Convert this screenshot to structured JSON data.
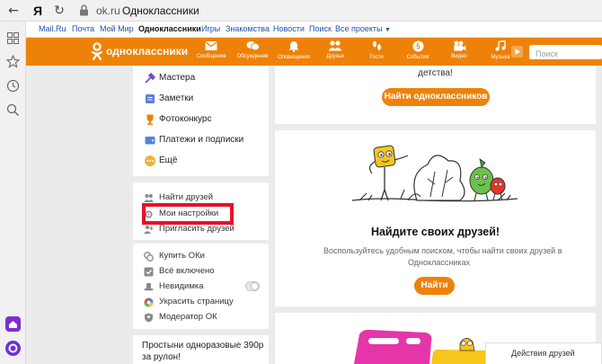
{
  "browser": {
    "url_domain": "ok.ru",
    "page_title": "Одноклассники"
  },
  "portal": {
    "links": [
      "Mail.Ru",
      "Почта",
      "Мой Мир",
      "Одноклассники",
      "Игры",
      "Знакомства",
      "Новости",
      "Поиск",
      "Все проекты"
    ],
    "active": "Одноклассники"
  },
  "header": {
    "logo_text": "одноклассники",
    "nav": [
      {
        "label": "Сообщения",
        "icon": "envelope-icon"
      },
      {
        "label": "Обсуждения",
        "icon": "chat-bubbles-icon"
      },
      {
        "label": "Оповещения",
        "icon": "bell-icon"
      },
      {
        "label": "Друзья",
        "icon": "friends-icon"
      },
      {
        "label": "Гости",
        "icon": "footprints-icon"
      },
      {
        "label": "События",
        "icon": "events-icon"
      },
      {
        "label": "Видео",
        "icon": "video-camera-icon"
      },
      {
        "label": "Музыка",
        "icon": "music-play-icon"
      }
    ],
    "search_placeholder": "Поиск",
    "brand_color": "#ee8208"
  },
  "sidebar": {
    "items_top": [
      {
        "label": "Мастера",
        "icon": "craft-icon"
      },
      {
        "label": "Заметки",
        "icon": "notes-icon"
      },
      {
        "label": "Фотоконкурс",
        "icon": "trophy-icon"
      },
      {
        "label": "Платежи и подписки",
        "icon": "wallet-icon"
      },
      {
        "label": "Ещё",
        "icon": "more-icon"
      }
    ],
    "items_middle": [
      {
        "label": "Найти друзей",
        "icon": "find-friends-icon"
      },
      {
        "label": "Мои настройки",
        "icon": "settings-icon"
      },
      {
        "label": "Пригласить друзей",
        "icon": "invite-icon"
      }
    ],
    "items_bottom": [
      {
        "label": "Купить ОКи",
        "icon": "coins-icon"
      },
      {
        "label": "Всё включено",
        "icon": "all-inclusive-icon"
      },
      {
        "label": "Невидимка",
        "icon": "invisible-hat-icon"
      },
      {
        "label": "Украсить страницу",
        "icon": "decorate-icon"
      },
      {
        "label": "Модератор ОК",
        "icon": "moderator-icon"
      }
    ],
    "promo_text": "Простыни одноразовые 390р за рулон!"
  },
  "main": {
    "card1": {
      "text_tail": "детства!",
      "button": "Найти одноклассников"
    },
    "card2": {
      "title": "Найдите своих друзей!",
      "desc_line1": "Воспользуйтесь удобным поиском, чтобы найти своих друзей в",
      "desc_line2": "Одноклассниках",
      "button": "Найти"
    }
  },
  "bottom_tab": "Действия друзей"
}
